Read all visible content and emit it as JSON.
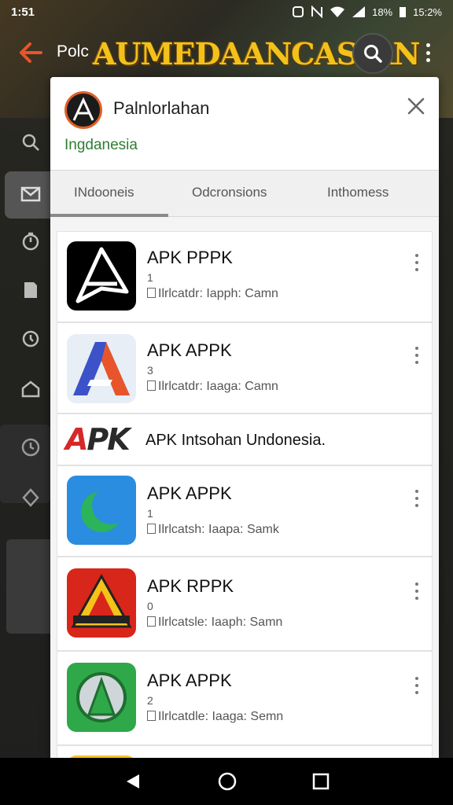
{
  "status": {
    "time": "1:51",
    "battery": "18%",
    "extra": "15:2%"
  },
  "appbar": {
    "partial_title": "Polc",
    "banner_title": "AUMEDAANCASIAN"
  },
  "dialog": {
    "title": "Palnlorlahan",
    "subtitle": "Ingdanesia",
    "tabs": [
      "INdooneis",
      "Odcronsions",
      "Inthomess"
    ]
  },
  "apps": [
    {
      "title": "APK PPPK",
      "num": "1",
      "sub": "Ilrlcatdr: Iapph: Camn"
    },
    {
      "title": "APK APPK",
      "num": "3",
      "sub": "Ilrlcatdr: Iaaga: Camn"
    },
    {
      "title": "APK APPK",
      "num": "1",
      "sub": "Ilrlcatsh: Iaapa: Samk"
    },
    {
      "title": "APK RPPK",
      "num": "0",
      "sub": "Ilrlcatsle: Iaaph: Samn"
    },
    {
      "title": "APK APPK",
      "num": "2",
      "sub": "Ilrlcatdle: Iaaga: Semn"
    }
  ],
  "banner": {
    "logo_a": "A",
    "logo_pk": "PK",
    "text": "APK Intsohan Undonesia."
  },
  "icons": {
    "back": "back-arrow-icon",
    "search": "search-icon",
    "more": "more-vert-icon",
    "close": "close-icon",
    "nav_back": "nav-back-icon",
    "nav_home": "nav-home-icon",
    "nav_recents": "nav-recents-icon"
  },
  "colors": {
    "accent_green": "#2e7d32",
    "banner_gold": "#f2c21a",
    "apk_red": "#d62828"
  }
}
